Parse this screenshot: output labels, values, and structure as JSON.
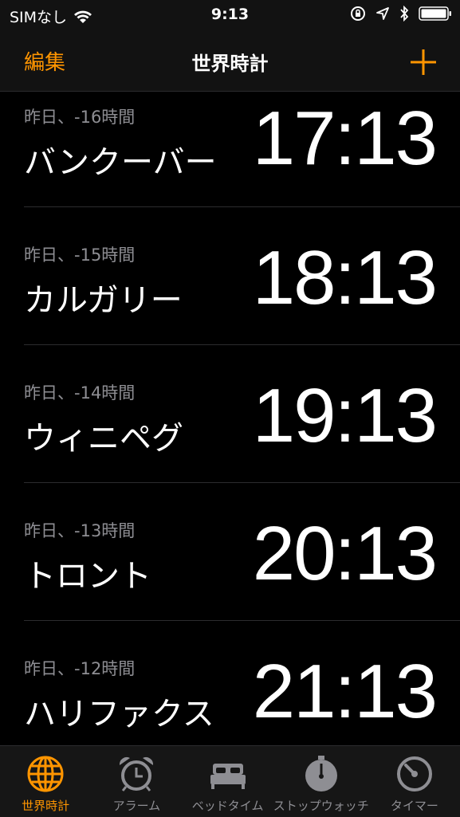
{
  "status": {
    "carrier": "SIMなし",
    "time": "9:13"
  },
  "nav": {
    "edit": "編集",
    "title": "世界時計"
  },
  "clocks": [
    {
      "offset": "昨日、-16時間",
      "city": "バンクーバー",
      "time": "17:13"
    },
    {
      "offset": "昨日、-15時間",
      "city": "カルガリー",
      "time": "18:13"
    },
    {
      "offset": "昨日、-14時間",
      "city": "ウィニペグ",
      "time": "19:13"
    },
    {
      "offset": "昨日、-13時間",
      "city": "トロント",
      "time": "20:13"
    },
    {
      "offset": "昨日、-12時間",
      "city": "ハリファクス",
      "time": "21:13"
    }
  ],
  "tabs": [
    {
      "label": "世界時計",
      "icon": "globe-icon",
      "active": true
    },
    {
      "label": "アラーム",
      "icon": "alarm-clock-icon",
      "active": false
    },
    {
      "label": "ベッドタイム",
      "icon": "bed-icon",
      "active": false
    },
    {
      "label": "ストップウォッチ",
      "icon": "stopwatch-icon",
      "active": false
    },
    {
      "label": "タイマー",
      "icon": "timer-icon",
      "active": false
    }
  ],
  "colors": {
    "accent": "#ff9500",
    "inactive": "#8e8e93",
    "background": "#000000"
  }
}
